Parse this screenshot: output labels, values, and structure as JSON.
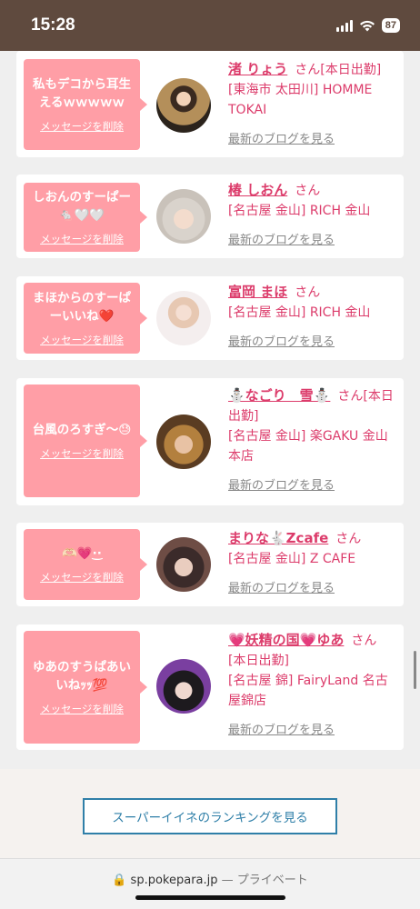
{
  "status_bar": {
    "time": "15:28",
    "battery": "87"
  },
  "messages": [
    {
      "text": "私もデコから耳生えるｗｗｗｗｗ",
      "delete_label": "メッセージを削除",
      "name": "渚 りょう",
      "san": "さん",
      "status": "[本日出勤]",
      "shop": "[東海市 太田川] HOMME TOKAI",
      "blog_label": "最新のブログを見る"
    },
    {
      "text": "しおんのすーぱー🐁🤍🤍",
      "delete_label": "メッセージを削除",
      "name": "椿 しおん",
      "san": "さん",
      "status": "",
      "shop": "[名古屋 金山] RICH 金山",
      "blog_label": "最新のブログを見る"
    },
    {
      "text": "まほからのすーぱーいいね❤️",
      "delete_label": "メッセージを削除",
      "name": "富岡 まほ",
      "san": "さん",
      "status": "",
      "shop": "[名古屋 金山] RICH 金山",
      "blog_label": "最新のブログを見る"
    },
    {
      "text": "台風のろすぎ〜😓",
      "delete_label": "メッセージを削除",
      "name": "⛄なごり　雪⛄",
      "san": "さん",
      "status": "[本日出勤]",
      "shop": "[名古屋 金山] 楽GAKU 金山本店",
      "blog_label": "最新のブログを見る"
    },
    {
      "text": "🫶🏻💗·͜·",
      "delete_label": "メッセージを削除",
      "name": "まりな🐇Zcafe",
      "san": "さん",
      "status": "",
      "shop": "[名古屋 金山] Z CAFE",
      "blog_label": "最新のブログを見る"
    },
    {
      "text": "ゆあのすうぱあいいねｯｯ💯",
      "delete_label": "メッセージを削除",
      "name": "💗妖精の国💗ゆあ",
      "san": "さん",
      "status": "[本日出勤]",
      "shop": "[名古屋 錦] FairyLand 名古屋錦店",
      "blog_label": "最新のブログを見る"
    }
  ],
  "ranking_button": "スーパーイイネのランキングを見る",
  "url_bar": {
    "domain": "sp.pokepara.jp",
    "privacy": "— プライベート"
  }
}
